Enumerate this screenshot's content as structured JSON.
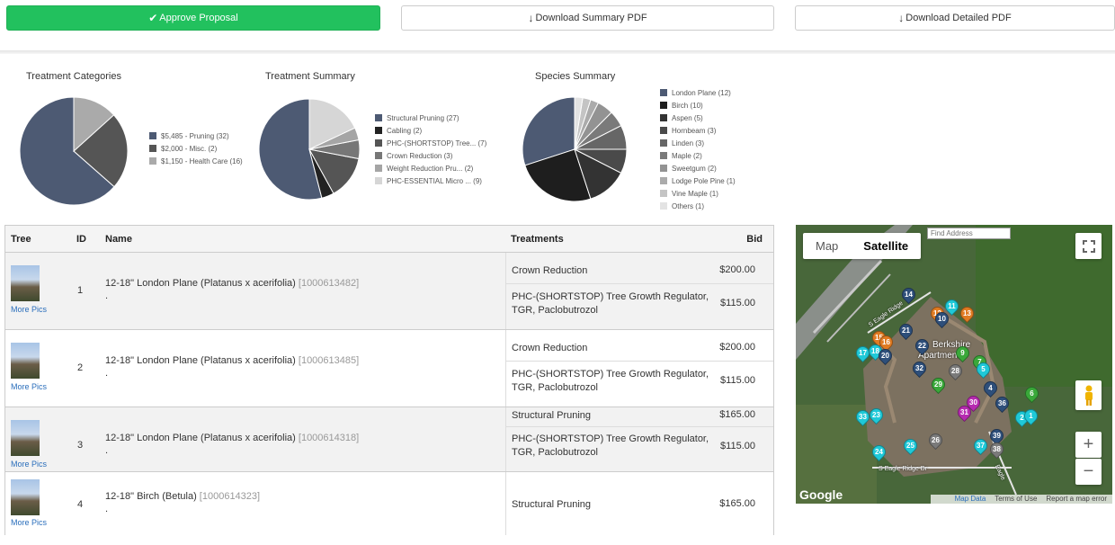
{
  "actions": {
    "approve_label": "Approve Proposal",
    "download_summary_label": "Download Summary PDF",
    "download_detailed_label": "Download Detailed PDF"
  },
  "colors": {
    "approve": "#22c15e",
    "slate": "#4d5a73",
    "dark": "#222222",
    "link": "#2a6ebb"
  },
  "chart_data": [
    {
      "type": "pie",
      "title": "Treatment Categories",
      "legend_position": "right",
      "slices": [
        {
          "label": "$5,485 - Pruning (32)",
          "value": 5485,
          "color": "#4d5a73"
        },
        {
          "label": "$2,000 - Misc. (2)",
          "value": 2000,
          "color": "#555555"
        },
        {
          "label": "$1,150 - Health Care (16)",
          "value": 1150,
          "color": "#aaaaaa"
        }
      ]
    },
    {
      "type": "pie",
      "title": "Treatment Summary",
      "legend_position": "right",
      "slices": [
        {
          "label": "Structural Pruning (27)",
          "value": 27,
          "color": "#4d5a73"
        },
        {
          "label": "Cabling (2)",
          "value": 2,
          "color": "#222222"
        },
        {
          "label": "PHC-(SHORTSTOP) Tree... (7)",
          "value": 7,
          "color": "#555555"
        },
        {
          "label": "Crown Reduction (3)",
          "value": 3,
          "color": "#777777"
        },
        {
          "label": "Weight Reduction Pru... (2)",
          "value": 2,
          "color": "#a5a5a5"
        },
        {
          "label": "PHC-ESSENTIAL Micro ... (9)",
          "value": 9,
          "color": "#d6d6d6"
        }
      ]
    },
    {
      "type": "pie",
      "title": "Species Summary",
      "legend_position": "right",
      "slices": [
        {
          "label": "London Plane (12)",
          "value": 12,
          "color": "#4d5a73"
        },
        {
          "label": "Birch (10)",
          "value": 10,
          "color": "#1e1e1e"
        },
        {
          "label": "Aspen (5)",
          "value": 5,
          "color": "#333333"
        },
        {
          "label": "Hornbeam (3)",
          "value": 3,
          "color": "#4a4a4a"
        },
        {
          "label": "Linden (3)",
          "value": 3,
          "color": "#666666"
        },
        {
          "label": "Maple (2)",
          "value": 2,
          "color": "#7a7a7a"
        },
        {
          "label": "Sweetgum (2)",
          "value": 2,
          "color": "#939393"
        },
        {
          "label": "Lodge Pole Pine (1)",
          "value": 1,
          "color": "#ababab"
        },
        {
          "label": "Vine Maple (1)",
          "value": 1,
          "color": "#c4c4c4"
        },
        {
          "label": "Others (1)",
          "value": 1,
          "color": "#e3e3e3"
        }
      ]
    }
  ],
  "table": {
    "headers": {
      "tree": "Tree",
      "id": "ID",
      "name": "Name",
      "treatments": "Treatments",
      "bid": "Bid"
    },
    "more_pics": "More Pics",
    "rows": [
      {
        "id": "1",
        "name": "12-18\" London Plane (Platanus x acerifolia)",
        "code": "[1000613482]",
        "dot": ".",
        "treatments": [
          {
            "name": "Crown Reduction",
            "bid": "$200.00"
          },
          {
            "name": "PHC-(SHORTSTOP) Tree Growth Regulator, TGR, Paclobutrozol",
            "bid": "$115.00"
          }
        ]
      },
      {
        "id": "2",
        "name": "12-18\" London Plane (Platanus x acerifolia)",
        "code": "[1000613485]",
        "dot": ".",
        "treatments": [
          {
            "name": "Crown Reduction",
            "bid": "$200.00"
          },
          {
            "name": "PHC-(SHORTSTOP) Tree Growth Regulator, TGR, Paclobutrozol",
            "bid": "$115.00"
          }
        ]
      },
      {
        "id": "3",
        "name": "12-18\" London Plane (Platanus x acerifolia)",
        "code": "[1000614318]",
        "dot": ".",
        "treatments": [
          {
            "name": "Structural Pruning",
            "bid": "$165.00"
          },
          {
            "name": "PHC-(SHORTSTOP) Tree Growth Regulator, TGR, Paclobutrozol",
            "bid": "$115.00"
          }
        ]
      },
      {
        "id": "4",
        "name": "12-18\" Birch (Betula)",
        "code": "[1000614323]",
        "dot": ".",
        "treatments": [
          {
            "name": "Structural Pruning",
            "bid": "$165.00"
          }
        ]
      }
    ]
  },
  "map": {
    "tab_map": "Map",
    "tab_satellite": "Satellite",
    "find_address_placeholder": "Find Address",
    "place_label": "Berkshire",
    "place_label_2": "Apartments",
    "road_1": "S Eagle Ridge",
    "road_2": "S Eagle Ridge Dr",
    "road_3": "Eagle",
    "google": "Google",
    "map_data": "Map Data",
    "terms": "Terms of Use",
    "report": "Report a map error",
    "markers": [
      {
        "n": "14",
        "color": "navy"
      },
      {
        "n": "11",
        "color": "cyan"
      },
      {
        "n": "12",
        "color": "orange"
      },
      {
        "n": "10",
        "color": "navy"
      },
      {
        "n": "13",
        "color": "orange"
      },
      {
        "n": "21",
        "color": "navy"
      },
      {
        "n": "15",
        "color": "orange"
      },
      {
        "n": "16",
        "color": "orange"
      },
      {
        "n": "17",
        "color": "cyan"
      },
      {
        "n": "18",
        "color": "cyan"
      },
      {
        "n": "20",
        "color": "navy"
      },
      {
        "n": "22",
        "color": "navy"
      },
      {
        "n": "9",
        "color": "green"
      },
      {
        "n": "7",
        "color": "green"
      },
      {
        "n": "32",
        "color": "navy"
      },
      {
        "n": "5",
        "color": "cyan"
      },
      {
        "n": "29",
        "color": "green"
      },
      {
        "n": "28",
        "color": "gray"
      },
      {
        "n": "4",
        "color": "navy"
      },
      {
        "n": "36",
        "color": "navy"
      },
      {
        "n": "30",
        "color": "magenta"
      },
      {
        "n": "31",
        "color": "magenta"
      },
      {
        "n": "6",
        "color": "green"
      },
      {
        "n": "33",
        "color": "cyan"
      },
      {
        "n": "23",
        "color": "cyan"
      },
      {
        "n": "39",
        "color": "navy"
      },
      {
        "n": "2",
        "color": "cyan"
      },
      {
        "n": "1",
        "color": "cyan"
      },
      {
        "n": "26",
        "color": "gray"
      },
      {
        "n": "25",
        "color": "cyan"
      },
      {
        "n": "37",
        "color": "cyan"
      },
      {
        "n": "38",
        "color": "gray"
      },
      {
        "n": "24",
        "color": "cyan"
      }
    ]
  }
}
